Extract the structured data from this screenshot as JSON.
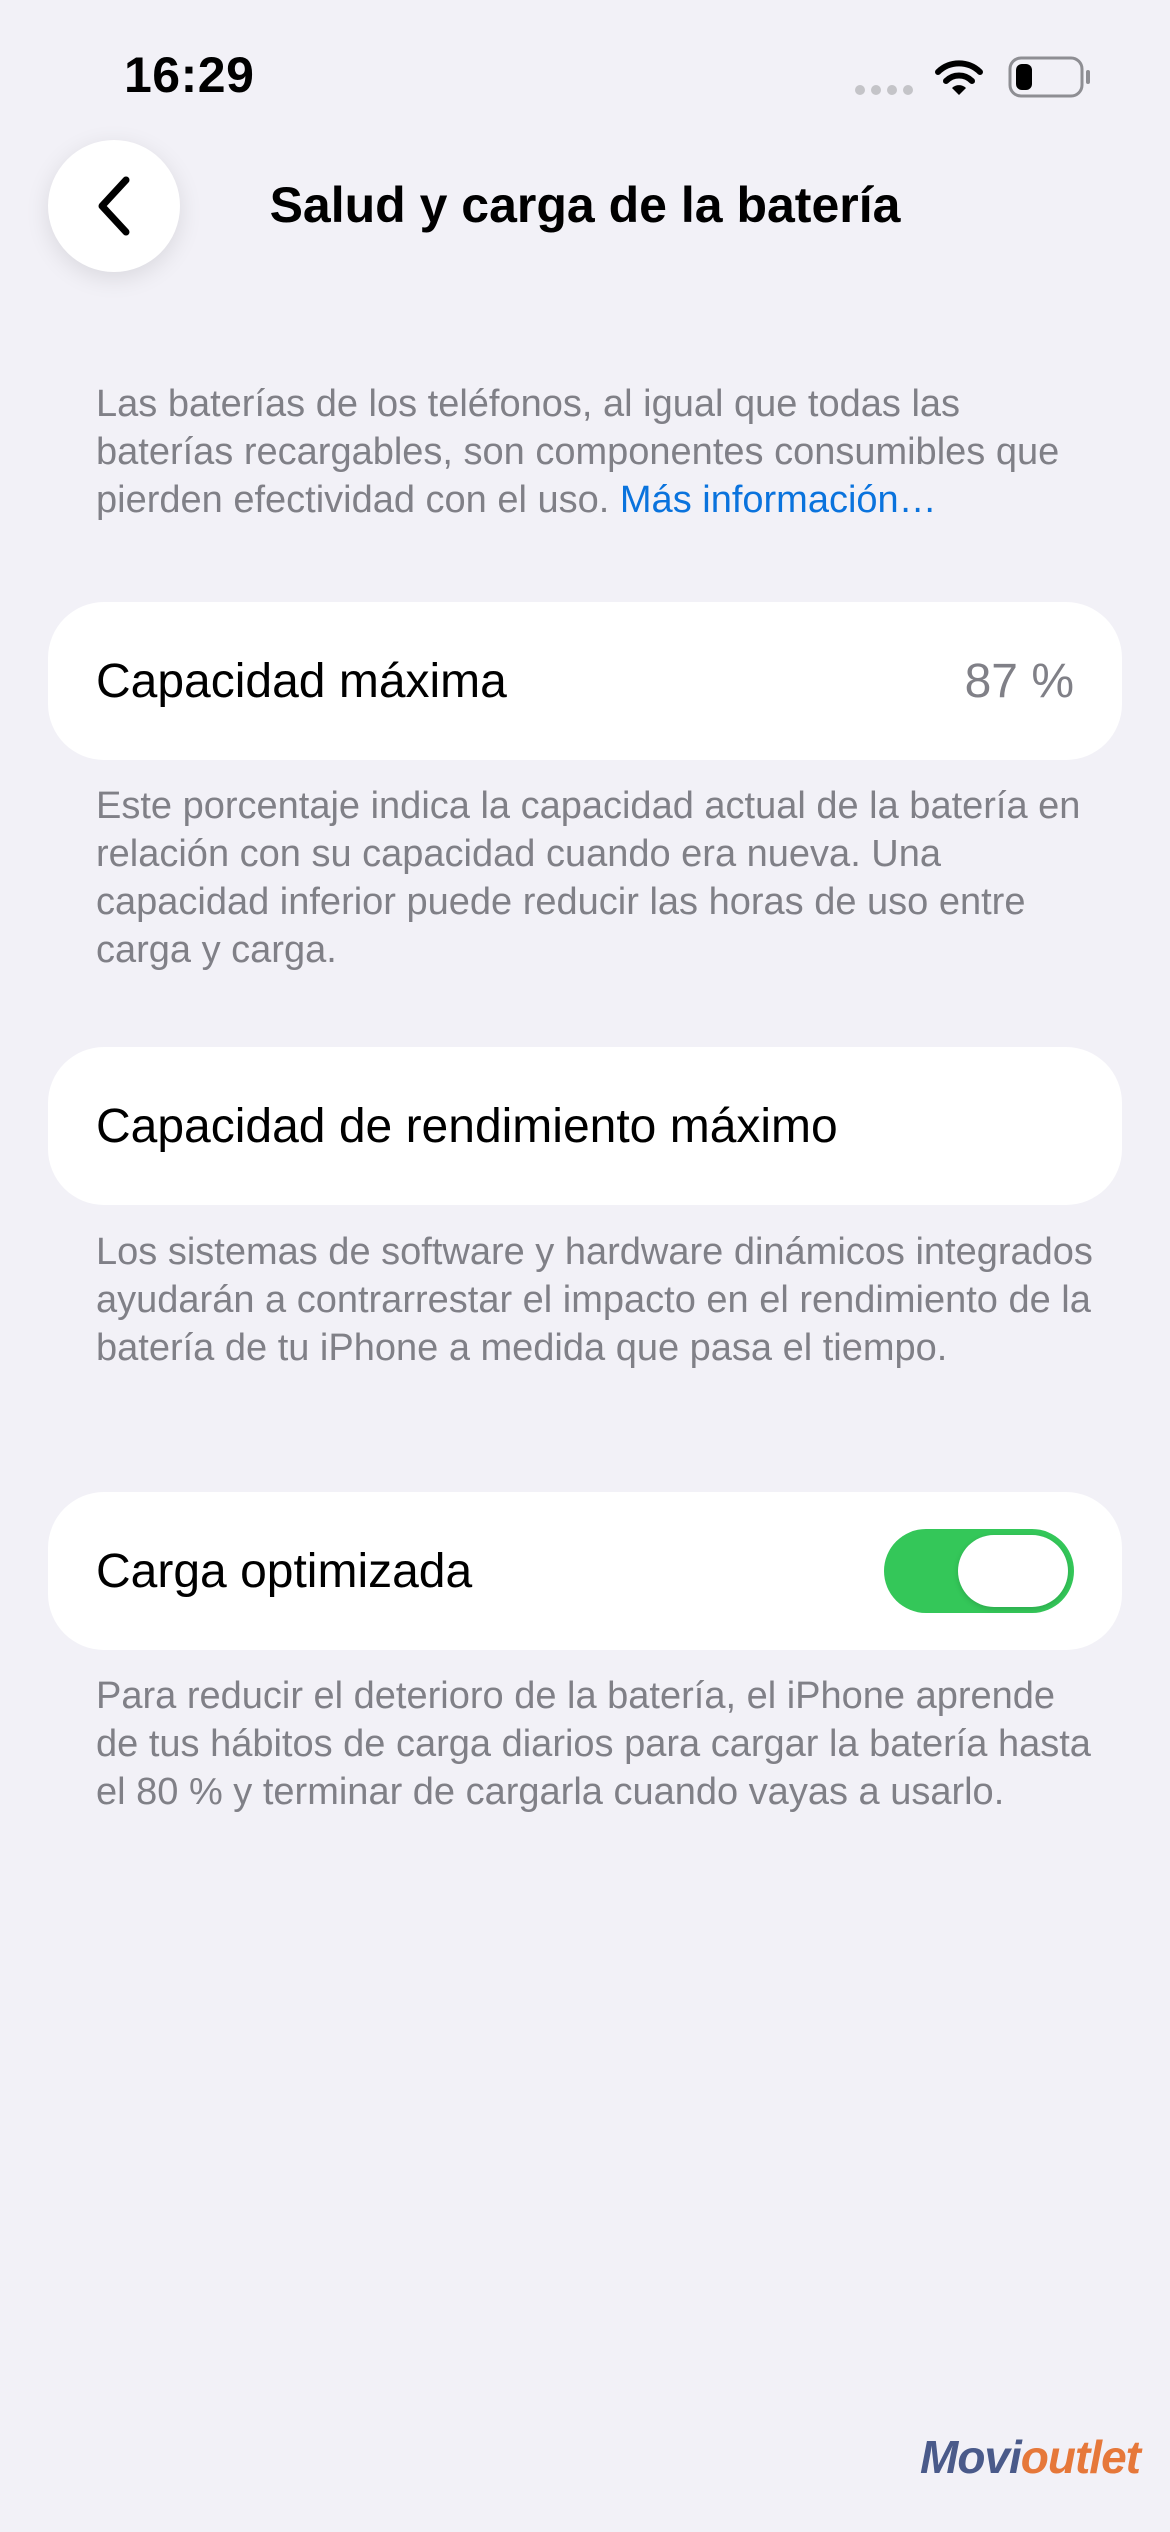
{
  "status_bar": {
    "time": "16:29",
    "signal_icon": "signal-dots-icon",
    "wifi_icon": "wifi-icon",
    "battery_icon": "battery-low-icon"
  },
  "nav": {
    "back_icon": "chevron-left-icon",
    "title": "Salud y carga de la batería"
  },
  "intro": {
    "text": "Las baterías de los teléfonos, al igual que todas las baterías recargables, son componentes consumibles que pierden efectividad con el uso.",
    "link": "Más información…"
  },
  "max_capacity": {
    "label": "Capacidad máxima",
    "value": "87 %",
    "description": "Este porcentaje indica la capacidad actual de la batería en relación con su capacidad cuando era nueva. Una capacidad inferior puede reducir las horas de uso entre carga y carga."
  },
  "peak_performance": {
    "label": "Capacidad de rendimiento máximo",
    "description": "Los sistemas de software y hardware dinámicos integrados ayudarán a contrarrestar el impacto en el rendimiento de la batería de tu iPhone a medida que pasa el tiempo."
  },
  "optimized_charging": {
    "label": "Carga optimizada",
    "enabled": true,
    "description": "Para reducir el deterioro de la batería, el iPhone aprende de tus hábitos de carga diarios para cargar la batería hasta el 80 % y terminar de cargarla cuando vayas a usarlo."
  },
  "watermark": {
    "part1": "Movi",
    "part2": "outlet"
  },
  "colors": {
    "background": "#f2f1f7",
    "link": "#0a73dd",
    "toggle_on": "#34c759",
    "secondary_text": "#808087"
  }
}
